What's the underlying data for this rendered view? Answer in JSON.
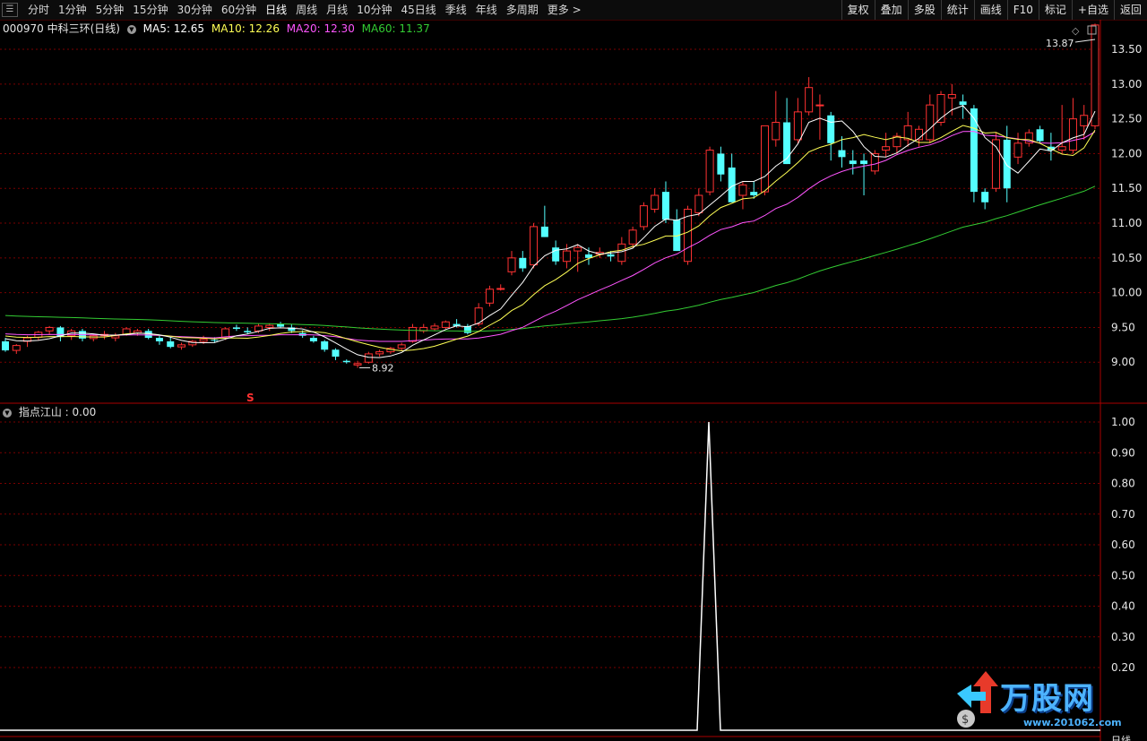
{
  "toolbar": {
    "period_tabs": [
      "分时",
      "1分钟",
      "5分钟",
      "15分钟",
      "30分钟",
      "60分钟",
      "日线",
      "周线",
      "月线",
      "10分钟",
      "45日线",
      "季线",
      "年线",
      "多周期",
      "更多 >"
    ],
    "active_tab": "日线",
    "right_tools": [
      "复权",
      "叠加",
      "多股",
      "统计",
      "画线",
      "F10",
      "标记",
      "+自选",
      "返回"
    ]
  },
  "stock": {
    "code_name": "000970 中科三环(日线)",
    "ma5": "MA5: 12.65",
    "ma10": "MA10: 12.26",
    "ma20": "MA20: 12.30",
    "ma60": "MA60: 11.37"
  },
  "indicator": {
    "label": "指点江山 : 0.00"
  },
  "markers": {
    "high_label": "13.87",
    "low_label": "8.92",
    "s_mark": "S"
  },
  "axis_labels": {
    "price": [
      "13.50",
      "13.00",
      "12.50",
      "12.00",
      "11.50",
      "11.00",
      "10.50",
      "10.00",
      "9.50",
      "9.00"
    ],
    "indicator": [
      "1.00",
      "0.90",
      "0.80",
      "0.70",
      "0.60",
      "0.50",
      "0.40",
      "0.30",
      "0.20"
    ],
    "bottom_right": "日线"
  },
  "watermark": {
    "text": "万股网",
    "url": "www.201062.com"
  },
  "colors": {
    "up": "#ff3232",
    "down": "#54ffff",
    "ma5": "#ffffff",
    "ma10": "#ffff55",
    "ma20": "#ff55ff",
    "ma60": "#33cc33",
    "grid": "#7a0000",
    "axis_text": "#e6e6e6"
  },
  "chart_data": [
    {
      "type": "candlestick",
      "ylim": [
        8.8,
        13.9
      ],
      "ohlc": [
        [
          9.3,
          9.35,
          9.15,
          9.17
        ],
        [
          9.17,
          9.26,
          9.12,
          9.24
        ],
        [
          9.3,
          9.38,
          9.22,
          9.35
        ],
        [
          9.36,
          9.45,
          9.32,
          9.43
        ],
        [
          9.45,
          9.52,
          9.4,
          9.5
        ],
        [
          9.5,
          9.52,
          9.3,
          9.37
        ],
        [
          9.38,
          9.48,
          9.32,
          9.45
        ],
        [
          9.45,
          9.48,
          9.3,
          9.34
        ],
        [
          9.34,
          9.4,
          9.3,
          9.38
        ],
        [
          9.38,
          9.45,
          9.33,
          9.4
        ],
        [
          9.35,
          9.42,
          9.3,
          9.38
        ],
        [
          9.4,
          9.5,
          9.38,
          9.48
        ],
        [
          9.42,
          9.48,
          9.38,
          9.45
        ],
        [
          9.45,
          9.48,
          9.33,
          9.35
        ],
        [
          9.35,
          9.38,
          9.25,
          9.3
        ],
        [
          9.3,
          9.36,
          9.2,
          9.22
        ],
        [
          9.22,
          9.28,
          9.18,
          9.25
        ],
        [
          9.25,
          9.32,
          9.22,
          9.3
        ],
        [
          9.3,
          9.38,
          9.26,
          9.33
        ],
        [
          9.32,
          9.36,
          9.28,
          9.31
        ],
        [
          9.35,
          9.5,
          9.32,
          9.48
        ],
        [
          9.5,
          9.54,
          9.45,
          9.48
        ],
        [
          9.45,
          9.5,
          9.4,
          9.43
        ],
        [
          9.45,
          9.55,
          9.42,
          9.52
        ],
        [
          9.5,
          9.56,
          9.45,
          9.53
        ],
        [
          9.55,
          9.58,
          9.5,
          9.51
        ],
        [
          9.5,
          9.55,
          9.42,
          9.45
        ],
        [
          9.42,
          9.46,
          9.35,
          9.38
        ],
        [
          9.35,
          9.38,
          9.28,
          9.3
        ],
        [
          9.3,
          9.32,
          9.15,
          9.18
        ],
        [
          9.18,
          9.2,
          9.03,
          9.08
        ],
        [
          9.02,
          9.04,
          8.98,
          9.0
        ],
        [
          8.96,
          9.02,
          8.92,
          8.98
        ],
        [
          9.0,
          9.15,
          8.98,
          9.12
        ],
        [
          9.12,
          9.18,
          9.08,
          9.15
        ],
        [
          9.15,
          9.22,
          9.12,
          9.2
        ],
        [
          9.2,
          9.28,
          9.16,
          9.25
        ],
        [
          9.3,
          9.55,
          9.28,
          9.5
        ],
        [
          9.45,
          9.55,
          9.42,
          9.5
        ],
        [
          9.48,
          9.56,
          9.45,
          9.52
        ],
        [
          9.5,
          9.6,
          9.48,
          9.58
        ],
        [
          9.55,
          9.62,
          9.5,
          9.52
        ],
        [
          9.52,
          9.55,
          9.4,
          9.42
        ],
        [
          9.55,
          9.85,
          9.52,
          9.78
        ],
        [
          9.85,
          10.1,
          9.8,
          10.05
        ],
        [
          10.05,
          10.12,
          10.03,
          10.06
        ],
        [
          10.3,
          10.6,
          10.25,
          10.5
        ],
        [
          10.5,
          10.6,
          10.3,
          10.35
        ],
        [
          10.4,
          11.0,
          10.35,
          10.95
        ],
        [
          10.95,
          11.25,
          10.8,
          10.8
        ],
        [
          10.65,
          10.75,
          10.4,
          10.45
        ],
        [
          10.45,
          10.7,
          10.35,
          10.6
        ],
        [
          10.6,
          10.7,
          10.3,
          10.65
        ],
        [
          10.55,
          10.65,
          10.4,
          10.5
        ],
        [
          10.55,
          10.65,
          10.5,
          10.58
        ],
        [
          10.55,
          10.6,
          10.45,
          10.52
        ],
        [
          10.45,
          10.8,
          10.4,
          10.7
        ],
        [
          10.7,
          10.95,
          10.65,
          10.9
        ],
        [
          10.95,
          11.3,
          10.9,
          11.25
        ],
        [
          11.2,
          11.5,
          11.15,
          11.4
        ],
        [
          11.45,
          11.6,
          11.0,
          11.05
        ],
        [
          11.05,
          11.2,
          10.6,
          10.6
        ],
        [
          10.45,
          11.25,
          10.4,
          11.2
        ],
        [
          11.15,
          11.5,
          11.1,
          11.4
        ],
        [
          11.45,
          12.1,
          11.4,
          12.05
        ],
        [
          12.0,
          12.1,
          11.6,
          11.7
        ],
        [
          11.8,
          12.0,
          11.3,
          11.3
        ],
        [
          11.4,
          11.6,
          11.2,
          11.55
        ],
        [
          11.45,
          11.6,
          11.35,
          11.4
        ],
        [
          11.45,
          12.1,
          11.4,
          12.4
        ],
        [
          12.2,
          12.9,
          12.1,
          12.45
        ],
        [
          12.45,
          12.8,
          11.85,
          11.85
        ],
        [
          12.2,
          12.8,
          12.15,
          12.6
        ],
        [
          12.6,
          13.1,
          12.55,
          12.95
        ],
        [
          12.7,
          12.85,
          12.2,
          12.7
        ],
        [
          12.55,
          12.6,
          11.9,
          12.15
        ],
        [
          12.05,
          12.25,
          11.8,
          11.95
        ],
        [
          11.9,
          12.05,
          11.7,
          11.85
        ],
        [
          11.9,
          12.0,
          11.4,
          11.85
        ],
        [
          11.75,
          12.05,
          11.7,
          12.0
        ],
        [
          12.05,
          12.3,
          11.95,
          12.1
        ],
        [
          12.1,
          12.3,
          12.0,
          12.25
        ],
        [
          12.2,
          12.6,
          12.1,
          12.4
        ],
        [
          12.2,
          12.4,
          12.1,
          12.35
        ],
        [
          12.2,
          12.85,
          12.15,
          12.7
        ],
        [
          12.45,
          12.9,
          12.4,
          12.85
        ],
        [
          12.8,
          13.0,
          12.55,
          12.85
        ],
        [
          12.75,
          12.85,
          12.5,
          12.7
        ],
        [
          12.65,
          12.7,
          11.3,
          11.45
        ],
        [
          11.45,
          11.5,
          11.2,
          11.3
        ],
        [
          11.5,
          12.3,
          11.45,
          12.2
        ],
        [
          12.2,
          12.4,
          11.3,
          11.5
        ],
        [
          11.95,
          12.3,
          11.85,
          12.15
        ],
        [
          12.15,
          12.35,
          12.1,
          12.3
        ],
        [
          12.35,
          12.4,
          12.15,
          12.18
        ],
        [
          12.1,
          12.3,
          11.9,
          12.05
        ],
        [
          12.05,
          12.7,
          12.0,
          12.1
        ],
        [
          12.05,
          12.8,
          12.0,
          12.5
        ],
        [
          12.4,
          12.7,
          12.2,
          12.55
        ],
        [
          12.4,
          13.87,
          12.35,
          13.85
        ]
      ],
      "note": "approximate OHLC for the visible daily candles"
    },
    {
      "type": "line",
      "name": "指点江山",
      "ylim": [
        0.1,
        1.05
      ],
      "spike_value": 1.0,
      "baseline": 0.0
    }
  ]
}
